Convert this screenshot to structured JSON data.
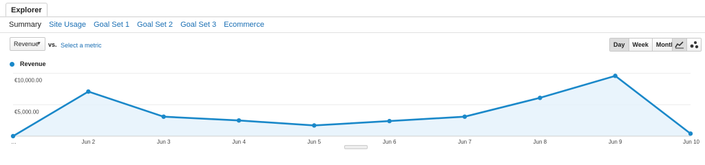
{
  "tab": {
    "label": "Explorer"
  },
  "subtabs": [
    "Summary",
    "Site Usage",
    "Goal Set 1",
    "Goal Set 2",
    "Goal Set 3",
    "Ecommerce"
  ],
  "metric": {
    "selected": "Revenue",
    "vs_label": "vs.",
    "select_link": "Select a metric"
  },
  "granularity": {
    "buttons": [
      "Day",
      "Week",
      "Month"
    ],
    "active": "Day"
  },
  "colors": {
    "series": "#1a88c9",
    "area": "#e4f1fb",
    "link": "#1a6fb4"
  },
  "chart_data": {
    "type": "area",
    "x": [
      "…",
      "Jun 2",
      "Jun 3",
      "Jun 4",
      "Jun 5",
      "Jun 6",
      "Jun 7",
      "Jun 8",
      "Jun 9",
      "Jun 10"
    ],
    "series": [
      {
        "name": "Revenue",
        "values": [
          0,
          7100,
          3100,
          2500,
          1700,
          2400,
          3100,
          6100,
          9600,
          400
        ]
      }
    ],
    "y_ticks": [
      "€10,000.00",
      "€5,000.00"
    ],
    "y_tick_values": [
      10000,
      5000
    ],
    "ylim": [
      0,
      11000
    ],
    "grid": true,
    "legend": "top-left"
  }
}
